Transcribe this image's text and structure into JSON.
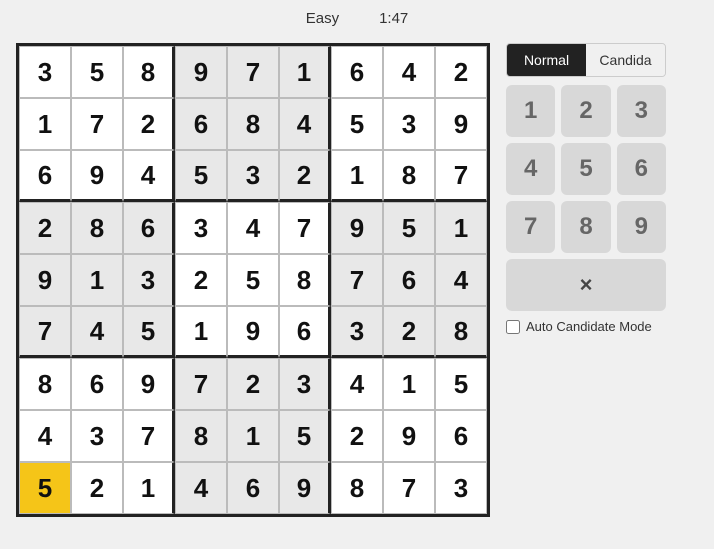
{
  "header": {
    "difficulty": "Easy",
    "timer": "1:47"
  },
  "mode_toggle": {
    "normal_label": "Normal",
    "candidate_label": "Candida"
  },
  "numpad": {
    "numbers": [
      "1",
      "2",
      "3",
      "4",
      "5",
      "6",
      "7",
      "8",
      "9"
    ],
    "delete_label": "×"
  },
  "auto_candidate": {
    "label": "Auto Candidate Mode",
    "checked": false
  },
  "board": {
    "cells": [
      [
        3,
        5,
        8,
        9,
        7,
        1,
        6,
        4,
        2
      ],
      [
        1,
        7,
        2,
        6,
        8,
        4,
        5,
        3,
        9
      ],
      [
        6,
        9,
        4,
        5,
        3,
        2,
        1,
        8,
        7
      ],
      [
        2,
        8,
        6,
        3,
        4,
        7,
        9,
        5,
        1
      ],
      [
        9,
        1,
        3,
        2,
        5,
        8,
        7,
        6,
        4
      ],
      [
        7,
        4,
        5,
        1,
        9,
        6,
        3,
        2,
        8
      ],
      [
        8,
        6,
        9,
        7,
        2,
        3,
        4,
        1,
        5
      ],
      [
        4,
        3,
        7,
        8,
        1,
        5,
        2,
        9,
        6
      ],
      [
        5,
        2,
        1,
        4,
        6,
        9,
        8,
        7,
        3
      ]
    ],
    "selected_row": 8,
    "selected_col": 0,
    "light_gray_cols_rows": "top-left 3x3 and middle 3x3 alternate shading"
  }
}
